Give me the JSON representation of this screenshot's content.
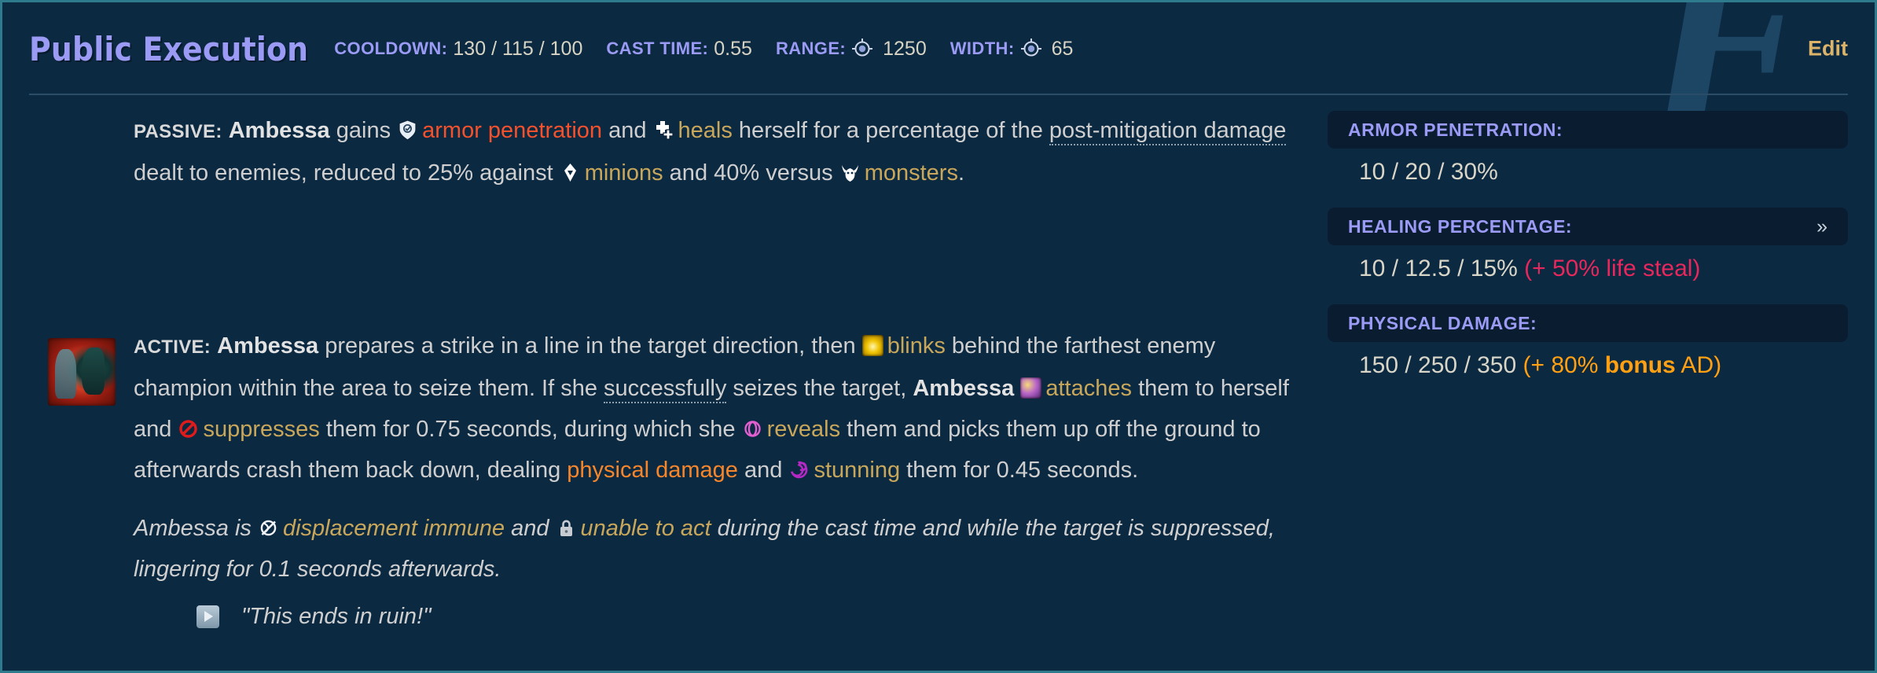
{
  "window": {
    "watermark_letter": "F",
    "edit_label": "Edit",
    "border_color": "#2d7b8c",
    "background_color": "#0c2942"
  },
  "header": {
    "ability_name": "Public Execution",
    "stats": [
      {
        "label": "COOLDOWN:",
        "value": "130 / 115 / 100",
        "icon": ""
      },
      {
        "label": "CAST TIME:",
        "value": "0.55",
        "icon": ""
      },
      {
        "label": "RANGE:",
        "value": "1250",
        "icon": "range-icon"
      },
      {
        "label": "WIDTH:",
        "value": "65",
        "icon": "range-icon"
      }
    ]
  },
  "passive": {
    "tag": "PASSIVE:",
    "champion": "Ambessa",
    "t1": " gains ",
    "kw_armor_pen": "armor penetration",
    "t2": " and ",
    "kw_heals": "heals",
    "t3": " herself for a percentage of the ",
    "dotted_post_mitigation": "post-mitigation damage",
    "t4": " dealt to enemies, reduced to 25% against ",
    "kw_minions": "minions",
    "t5": " and 40% versus ",
    "kw_monsters": "monsters",
    "t6": "."
  },
  "active": {
    "tag": "ACTIVE:",
    "champion": "Ambessa",
    "t1": " prepares a strike in a line in the target direction, then ",
    "kw_blinks": "blinks",
    "t2": " behind the farthest enemy champion within the area to seize them. If she ",
    "dotted_successfully": "successfully",
    "t3": " seizes the target, ",
    "champion2": "Ambessa",
    "t4": " ",
    "kw_attaches": "attaches",
    "t5": " them to herself and ",
    "kw_suppresses": "suppresses",
    "t6": " them for 0.75 seconds, during which she ",
    "kw_reveals": "reveals",
    "t7": " them and picks them up off the ground to afterwards crash them back down, dealing ",
    "kw_physical_damage": "physical damage",
    "t8": " and ",
    "kw_stunning": "stunning",
    "t9": " them for 0.45 seconds."
  },
  "note": {
    "champion": "Ambessa",
    "t1": " is ",
    "kw_displacement_immune": "displacement immune",
    "t2": " and ",
    "kw_unable_to_act": "unable to act",
    "t3": " during the cast time and while the target is suppressed, lingering for 0.1 seconds afterwards."
  },
  "quote": {
    "text": "\"This ends in ruin!\""
  },
  "panels": [
    {
      "title": "ARMOR PENETRATION:",
      "value": "10 / 20 / 30%",
      "extra": "",
      "extra_style": "",
      "chevron": ""
    },
    {
      "title": "HEALING PERCENTAGE:",
      "value": "10 / 12.5 / 15%",
      "extra": "(+ 50% life steal)",
      "extra_style": "pink",
      "chevron": "»"
    },
    {
      "title": "PHYSICAL DAMAGE:",
      "value": "150 / 250 / 350",
      "extra": "(+ 80% bonus AD)",
      "extra_bold_word": "bonus",
      "extra_style": "orange",
      "chevron": ""
    }
  ],
  "colors": {
    "title_purple": "#9b9bf5",
    "gold_keyword": "#c9a75a",
    "armor_pen_red": "#f4512c",
    "physical_damage_orange": "#f7862b",
    "life_steal_pink": "#e8275c",
    "bonus_ad_orange": "#ffa013",
    "edit_gold": "#dbb46a"
  }
}
